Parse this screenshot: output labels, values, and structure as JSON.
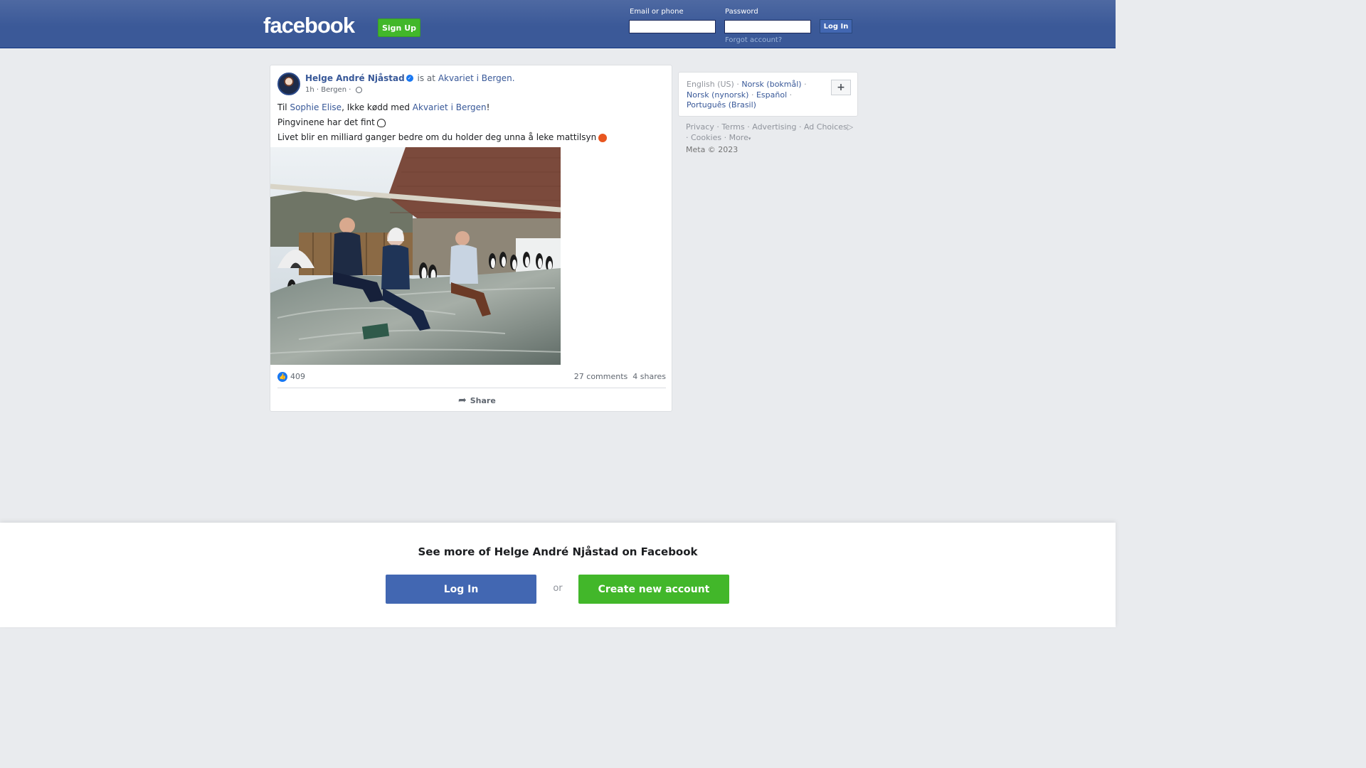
{
  "header": {
    "logo_text": "facebook",
    "signup_label": "Sign Up",
    "email_label": "Email or phone",
    "email_value": "",
    "password_label": "Password",
    "password_value": "",
    "login_label": "Log In",
    "forgot_label": "Forgot account?"
  },
  "post": {
    "author": "Helge André Njåstad",
    "verified_icon": "verified-badge-icon",
    "activity": "is at",
    "place": "Akvariet i Bergen",
    "place_suffix": ".",
    "time": "1h",
    "location": "Bergen",
    "audience_icon": "globe-icon",
    "line1_prefix": "Til",
    "line1_tag1": "Sophie Elise",
    "line1_middle": ", Ikke kødd med",
    "line1_tag2": "Akvariet i Bergen",
    "line1_suffix": "!",
    "line2": "Pingvinene har det fint",
    "line2_emoji": "penguin-emoji",
    "line3": "Livet blir en milliard ganger bedre om du holder deg unna å leke mattilsyn",
    "line3_emoji": "angry-face-emoji",
    "photo": "photo of three people sitting on a rock at the penguin enclosure",
    "like_icon": "like-thumb-icon",
    "likes": "409",
    "comments": "27 comments",
    "shares": "4 shares",
    "share_label": "Share",
    "share_icon": "share-arrow-icon"
  },
  "languages": {
    "current": "English (US)",
    "items": [
      "Norsk (bokmål)",
      "Norsk (nynorsk)",
      "Español",
      "Português (Brasil)"
    ],
    "more_icon": "plus-icon"
  },
  "footer": {
    "links": [
      "Privacy",
      "Terms",
      "Advertising",
      "Ad Choices",
      "Cookies",
      "More"
    ],
    "copyright": "Meta © 2023"
  },
  "banner": {
    "title": "See more of Helge André Njåstad on Facebook",
    "login_label": "Log In",
    "or_label": "or",
    "create_label": "Create new account"
  },
  "colors": {
    "brand_blue": "#3b5998",
    "button_blue": "#4267b2",
    "green": "#42b72a",
    "link": "#385898"
  }
}
